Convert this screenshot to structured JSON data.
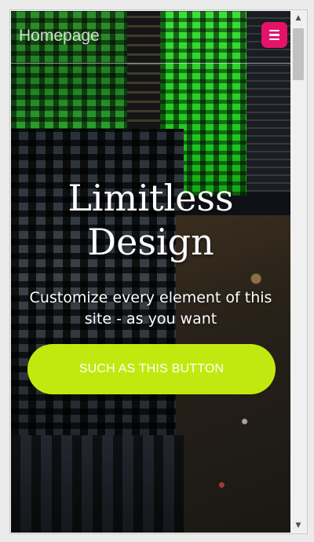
{
  "header": {
    "brand": "Homepage",
    "menu_icon": "hamburger-menu-icon"
  },
  "hero": {
    "title_line1": "Limitless",
    "title_line2": "Design",
    "subtitle": "Customize every element of this site - as you want",
    "cta_label": "SUCH AS THIS BUTTON"
  },
  "colors": {
    "menu_button": "#e4136a",
    "cta_button": "#c2e90f",
    "text": "#ffffff"
  },
  "scrollbar": {
    "up_icon": "scroll-up-arrow-icon",
    "down_icon": "scroll-down-arrow-icon"
  }
}
